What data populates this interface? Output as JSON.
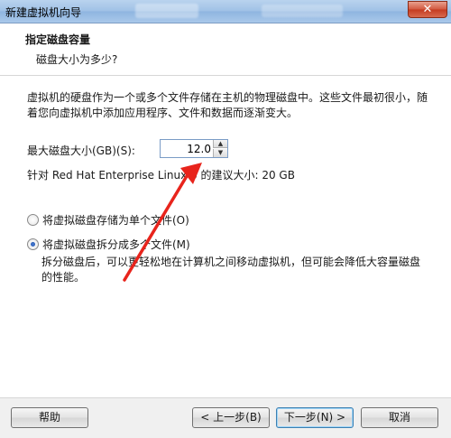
{
  "window": {
    "title": "新建虚拟机向导",
    "close_label": "✕"
  },
  "header": {
    "title": "指定磁盘容量",
    "subtitle": "磁盘大小为多少?"
  },
  "content": {
    "description": "虚拟机的硬盘作为一个或多个文件存储在主机的物理磁盘中。这些文件最初很小，随着您向虚拟机中添加应用程序、文件和数据而逐渐变大。",
    "max_size_label": "最大磁盘大小(GB)(S):",
    "max_size_value": "12.0",
    "recommendation": "针对 Red Hat Enterprise Linux 6 的建议大小: 20 GB",
    "radio_single": {
      "label": "将虚拟磁盘存储为单个文件(O)",
      "checked": false
    },
    "radio_split": {
      "label": "将虚拟磁盘拆分成多个文件(M)",
      "checked": true
    },
    "split_description": "拆分磁盘后，可以更轻松地在计算机之间移动虚拟机，但可能会降低大容量磁盘的性能。"
  },
  "footer": {
    "help_label": "帮助",
    "back_label": "< 上一步(B)",
    "next_label": "下一步(N) >",
    "cancel_label": "取消"
  },
  "annotation": {
    "arrow_color": "#e8241c"
  }
}
